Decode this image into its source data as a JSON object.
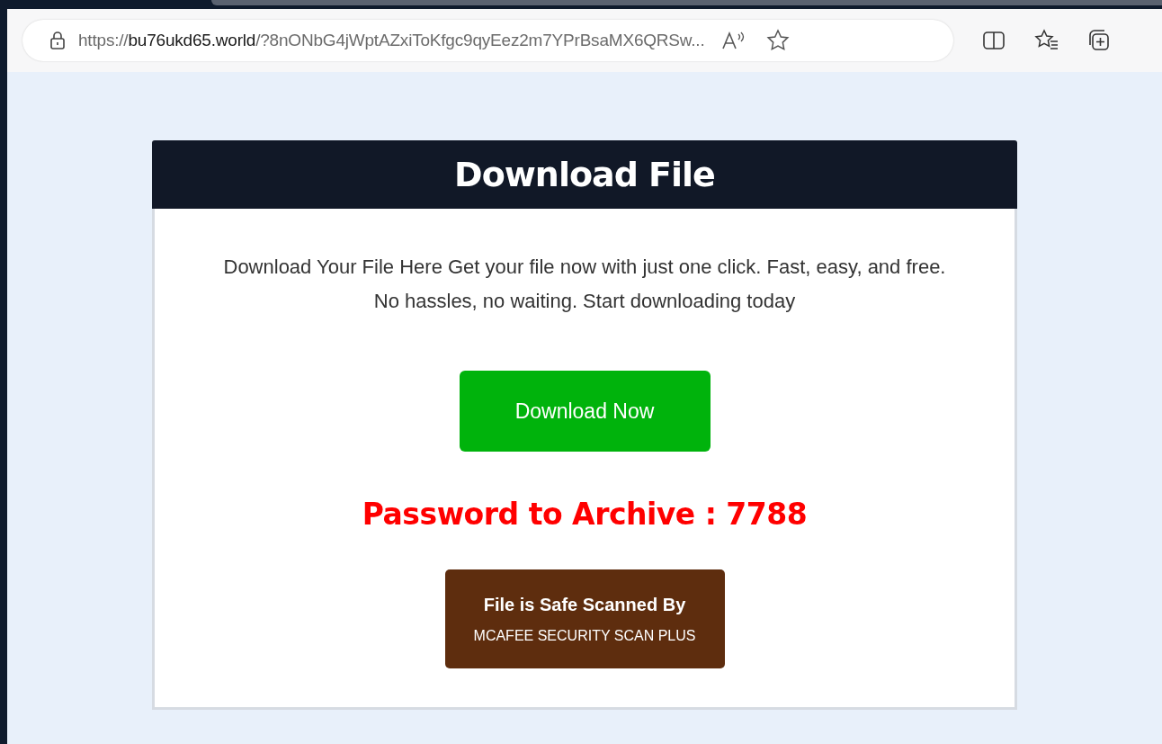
{
  "browser": {
    "address": "https://**bu76ukd65.world**/?8nONbG4jWptAZxiToKfgc9qyEez2m7YPrBsaMX6QRSw..."
  },
  "card": {
    "title": "Download File",
    "description": [
      "Download Your File Here Get your file now with just one click. Fast, easy, and free.",
      "No hassles, no waiting. Start downloading today"
    ],
    "button": "Download Now",
    "password": "Password to Archive : 7788",
    "badge": {
      "title": "File is Safe Scanned By",
      "subtitle": "MCAFEE SECURITY SCAN PLUS"
    }
  }
}
